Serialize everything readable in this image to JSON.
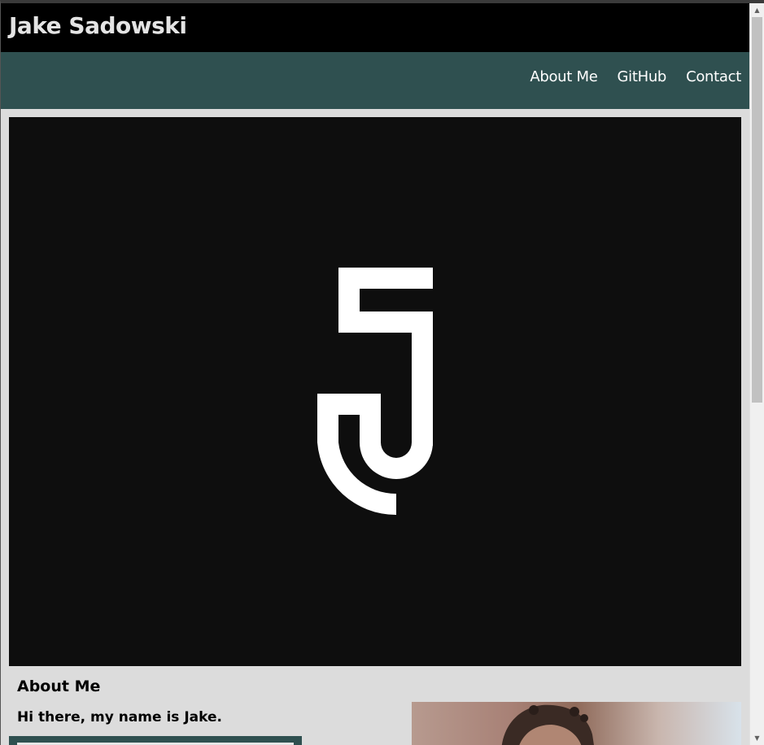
{
  "header": {
    "site_title": "Jake Sadowski"
  },
  "nav": {
    "items": [
      {
        "label": "About Me"
      },
      {
        "label": "GitHub"
      },
      {
        "label": "Contact"
      }
    ]
  },
  "hero": {
    "logo_icon": "jake-j-logo-icon",
    "background_color": "#0e0e0e",
    "logo_color": "#ffffff"
  },
  "about": {
    "heading": "About Me",
    "intro": "Hi there, my name is Jake."
  },
  "colors": {
    "header_bg": "#000000",
    "nav_bg": "#2f5050",
    "page_bg": "#dcdcdc"
  },
  "scrollbar": {
    "up_icon": "chevron-up-icon",
    "down_icon": "chevron-down-icon"
  }
}
